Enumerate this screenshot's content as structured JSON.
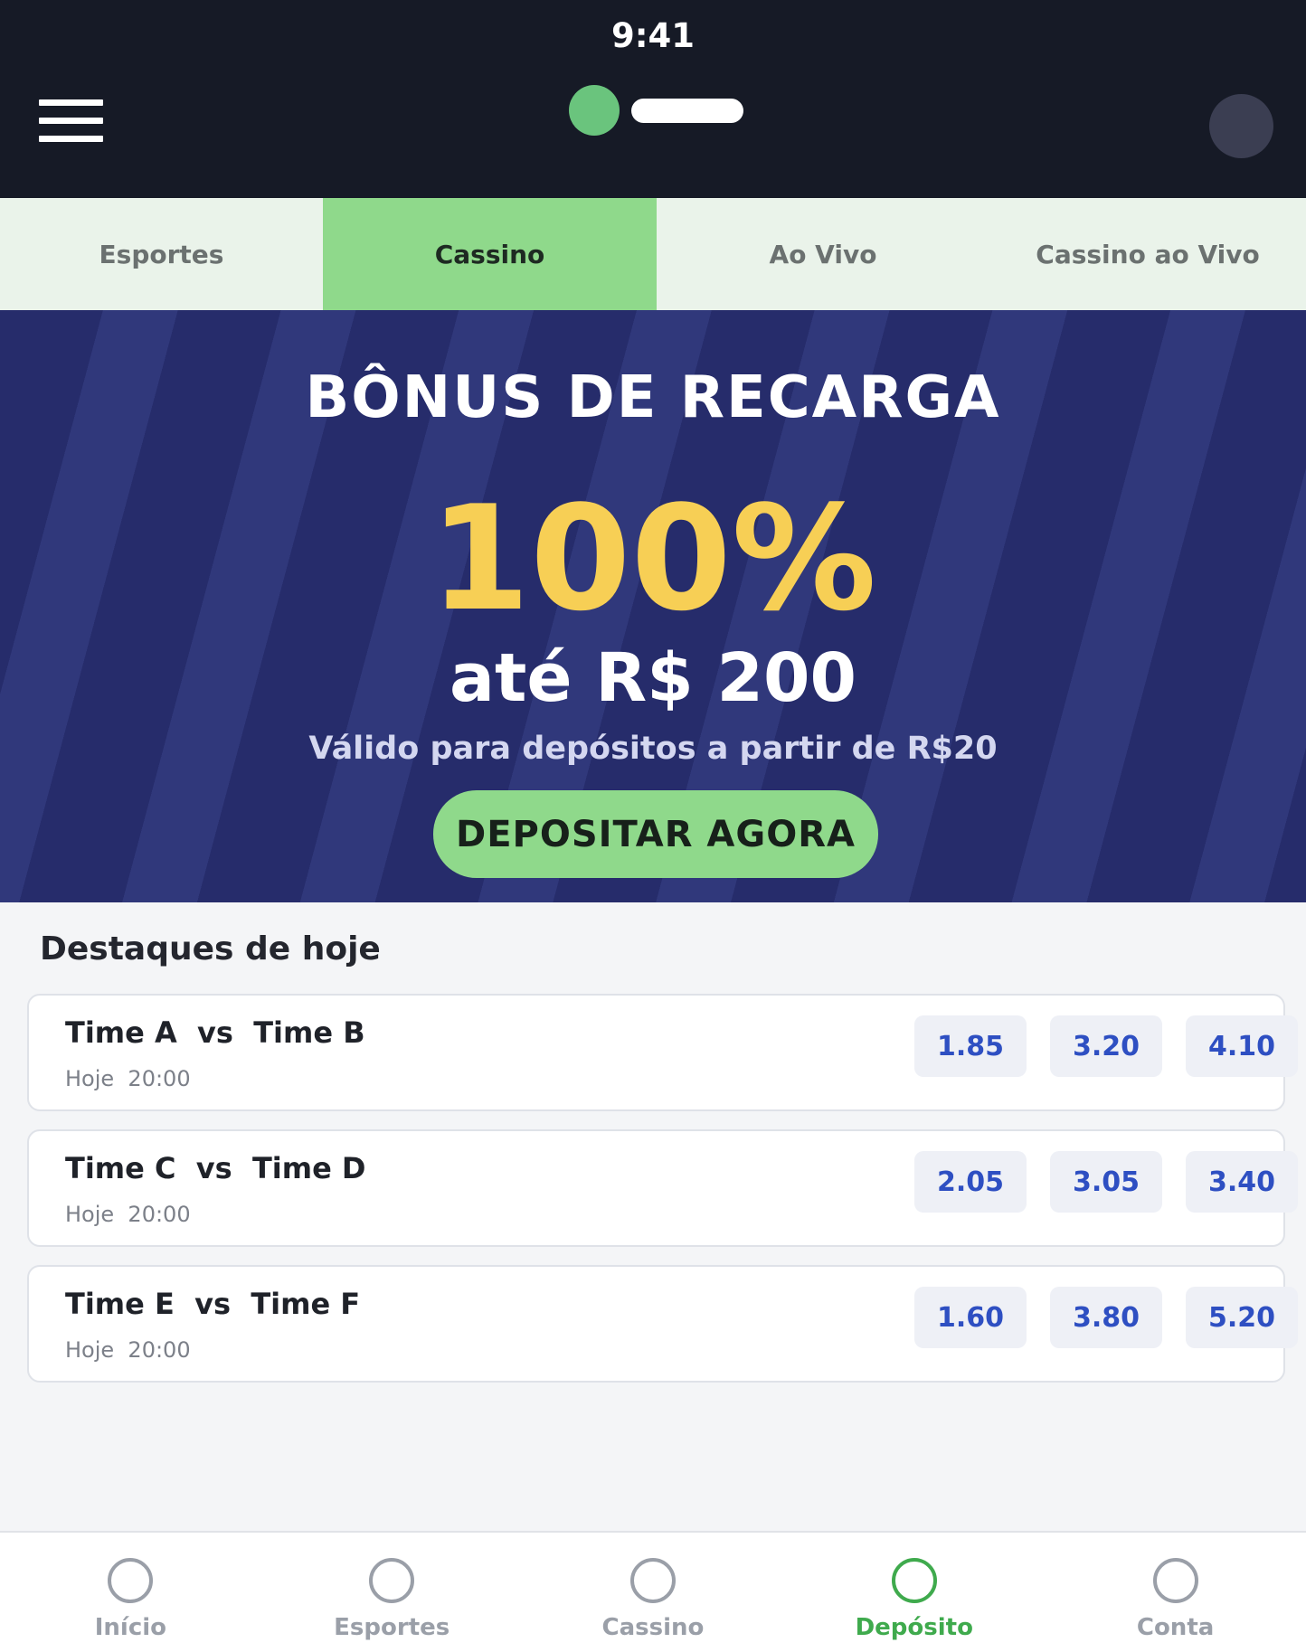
{
  "status_bar": {
    "time": "9:41"
  },
  "header": {
    "menu_icon": "hamburger-icon",
    "logo_color": "#6ac47d",
    "avatar_icon": "avatar"
  },
  "tabs": [
    {
      "label": "Esportes",
      "active": false
    },
    {
      "label": "Cassino",
      "active": true
    },
    {
      "label": "Ao Vivo",
      "active": false
    },
    {
      "label": "Cassino ao Vivo",
      "active": false
    }
  ],
  "banner": {
    "title": "BÔNUS DE RECARGA",
    "percent": "100%",
    "amount": "até R$ 200",
    "note": "Válido para depósitos a partir de R$20",
    "cta_label": "DEPOSITAR AGORA"
  },
  "highlights": {
    "title": "Destaques de hoje",
    "matches": [
      {
        "name": "Time A  vs  Time B",
        "time": "Hoje  20:00",
        "odds": [
          "1.85",
          "3.20",
          "4.10"
        ]
      },
      {
        "name": "Time C  vs  Time D",
        "time": "Hoje  20:00",
        "odds": [
          "2.05",
          "3.05",
          "3.40"
        ]
      },
      {
        "name": "Time E  vs  Time F",
        "time": "Hoje  20:00",
        "odds": [
          "1.60",
          "3.80",
          "5.20"
        ]
      }
    ]
  },
  "bottom_nav": [
    {
      "label": "Início",
      "icon": "circle-icon",
      "active": false
    },
    {
      "label": "Esportes",
      "icon": "circle-icon",
      "active": false
    },
    {
      "label": "Cassino",
      "icon": "circle-icon",
      "active": false
    },
    {
      "label": "Depósito",
      "icon": "circle-icon",
      "active": true
    },
    {
      "label": "Conta",
      "icon": "circle-icon",
      "active": false
    }
  ],
  "colors": {
    "header_bg": "#161a26",
    "accent_green": "#8fd98b",
    "active_nav": "#3faa4d",
    "banner_bg": "#262c6b",
    "highlight_yellow": "#f7cf55",
    "odds_text": "#2e4fc2"
  }
}
